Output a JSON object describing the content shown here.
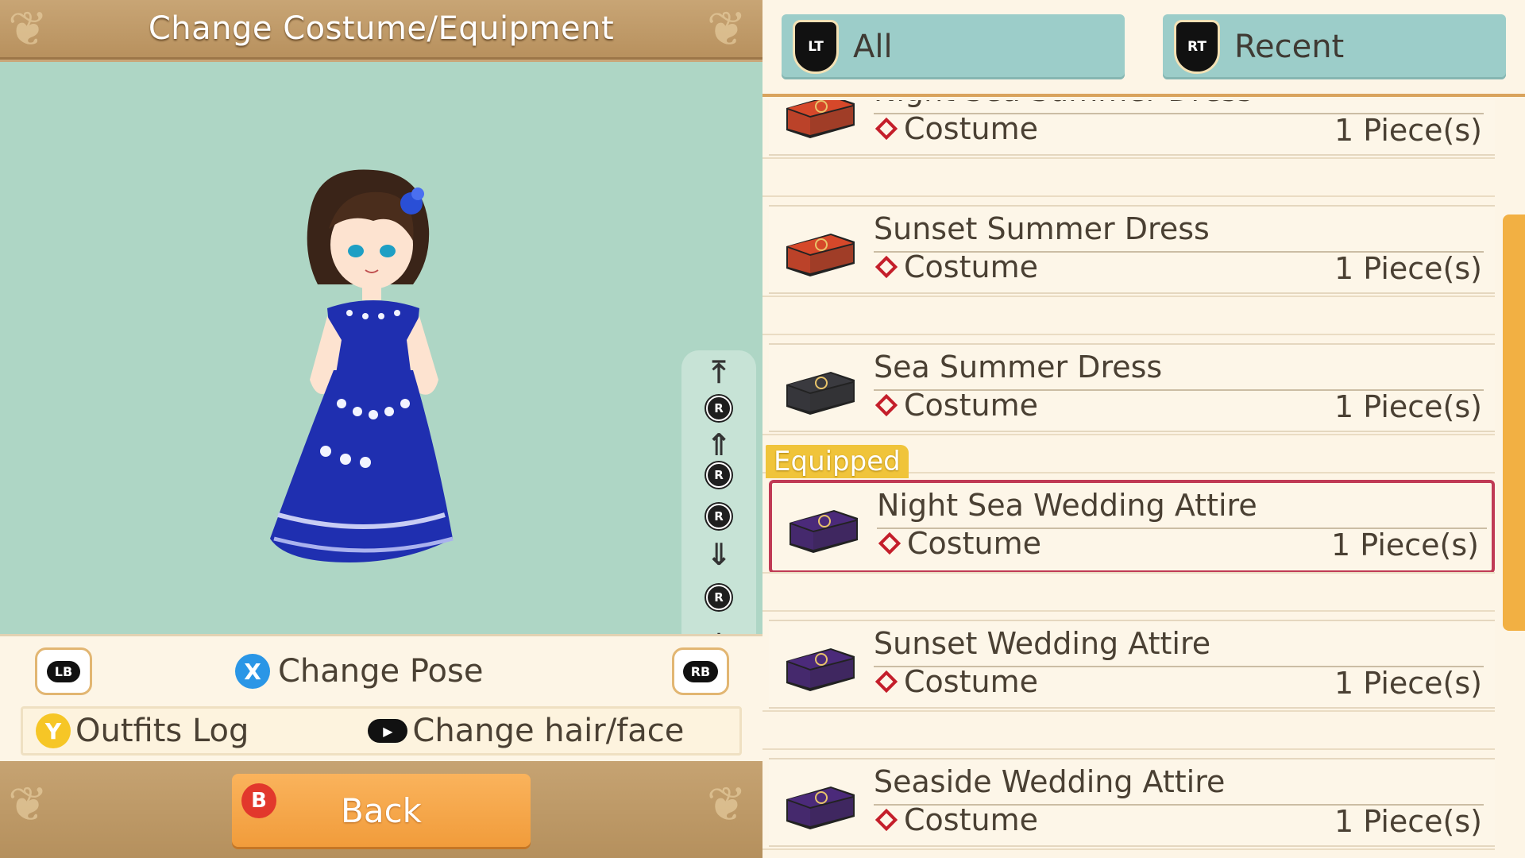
{
  "header": {
    "title": "Change Costume/Equipment"
  },
  "camera_controls": {
    "top_icon": "jump-to-top-icon",
    "bottom_icon": "jump-to-bottom-icon",
    "stick_label": "R"
  },
  "controls": {
    "lb": "LB",
    "rb": "RB",
    "x_button": "X",
    "change_pose": "Change Pose",
    "y_button": "Y",
    "outfits_log": "Outfits Log",
    "change_hair_face": "Change hair/face"
  },
  "footer": {
    "b_button": "B",
    "back": "Back"
  },
  "tabs": [
    {
      "badge": "LT",
      "label": "All"
    },
    {
      "badge": "RT",
      "label": "Recent"
    }
  ],
  "equipped_label": "Equipped",
  "items": [
    {
      "name": "Night Sea Summer Dress",
      "type": "Costume",
      "count": "1 Piece(s)",
      "chest": "#d6482a",
      "equipped": false
    },
    {
      "name": "Sunset Summer Dress",
      "type": "Costume",
      "count": "1 Piece(s)",
      "chest": "#d6482a",
      "equipped": false
    },
    {
      "name": "Sea Summer Dress",
      "type": "Costume",
      "count": "1 Piece(s)",
      "chest": "#3a3a3f",
      "equipped": false
    },
    {
      "name": "Night Sea Wedding Attire",
      "type": "Costume",
      "count": "1 Piece(s)",
      "chest": "#4b2a7a",
      "equipped": true
    },
    {
      "name": "Sunset Wedding Attire",
      "type": "Costume",
      "count": "1 Piece(s)",
      "chest": "#4b2a7a",
      "equipped": false
    },
    {
      "name": "Seaside Wedding Attire",
      "type": "Costume",
      "count": "1 Piece(s)",
      "chest": "#4b2a7a",
      "equipped": false
    }
  ],
  "colors": {
    "equipped_border": "#c03a55",
    "equipped_tag": "#f0c43a",
    "tab_bg": "#9ccdc9",
    "stage_bg": "#aed6c5",
    "dress": "#1f2fb0"
  }
}
